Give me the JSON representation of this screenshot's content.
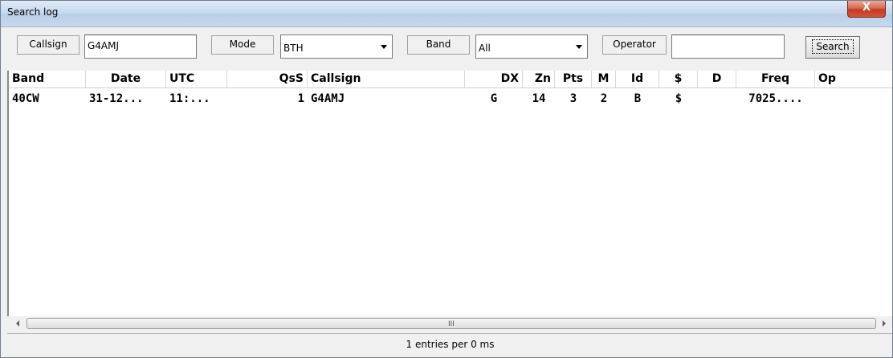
{
  "window": {
    "title": "Search log",
    "close_glyph": "X"
  },
  "toolbar": {
    "callsign_label": "Callsign",
    "callsign_value": "G4AMJ",
    "mode_label": "Mode",
    "mode_value": "BTH",
    "band_label": "Band",
    "band_value": "All",
    "operator_label": "Operator",
    "operator_value": "",
    "search_label": "Search"
  },
  "table": {
    "columns": [
      "Band",
      "Date",
      "UTC",
      "QsS",
      "Callsign",
      "DX",
      "Zn",
      "Pts",
      "M",
      "Id",
      "$",
      "D",
      "Freq",
      "Op"
    ],
    "rows": [
      [
        "40CW",
        "31-12...",
        "11:...",
        "1",
        "G4AMJ",
        "G",
        "14",
        "3",
        "2",
        "B",
        "$",
        "",
        "7025....",
        ""
      ]
    ]
  },
  "scrollbar": {
    "grip": "III"
  },
  "status": {
    "text": "1 entries per 0 ms"
  }
}
